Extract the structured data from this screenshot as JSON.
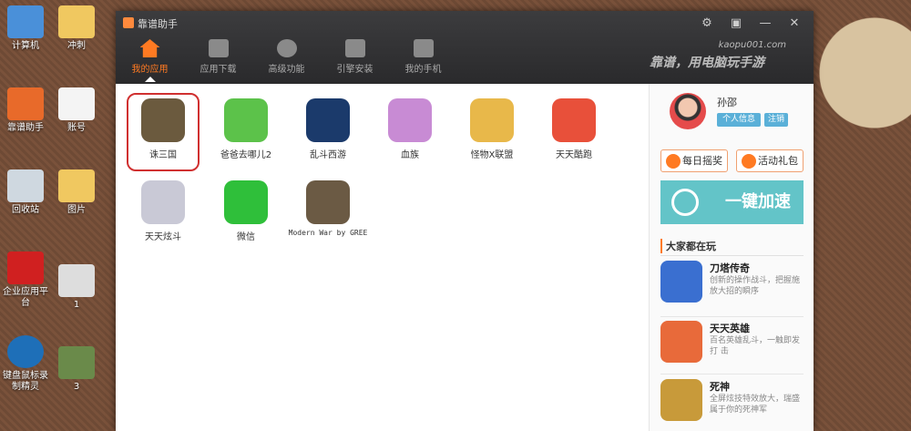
{
  "window": {
    "title": "靠谱助手",
    "site": "kaopu001.com",
    "slogan": "靠谱，用电脑玩手游",
    "controls": {
      "settings": "⚙",
      "minimize_to": "▣",
      "minimize": "—",
      "close": "✕"
    }
  },
  "nav": [
    {
      "label": "我的应用",
      "icon": "home-icon"
    },
    {
      "label": "应用下载",
      "icon": "download-icon"
    },
    {
      "label": "高级功能",
      "icon": "gears-icon"
    },
    {
      "label": "引擎安装",
      "icon": "drive-icon"
    },
    {
      "label": "我的手机",
      "icon": "phone-exit-icon"
    }
  ],
  "apps": [
    {
      "label": "诛三国",
      "color": "#6b5a3e"
    },
    {
      "label": "爸爸去哪儿2",
      "color": "#5cc24a"
    },
    {
      "label": "乱斗西游",
      "color": "#1b3a6b"
    },
    {
      "label": "血族",
      "color": "#c88bd4"
    },
    {
      "label": "怪物X联盟",
      "color": "#e8b84a"
    },
    {
      "label": "天天酷跑",
      "color": "#e8503a"
    },
    {
      "label": "天天炫斗",
      "color": "#c9c9d6"
    },
    {
      "label": "微信",
      "color": "#2fbf3a"
    },
    {
      "label": "Modern War by GREE",
      "color": "#6b5a44"
    }
  ],
  "user": {
    "name": "孙邵",
    "info_btn": "个人信息",
    "logout_btn": "注销"
  },
  "sidebar": {
    "daily": "每日摇奖",
    "gift": "活动礼包",
    "boost": "一键加速",
    "hot_title": "大家都在玩",
    "hot": [
      {
        "name": "刀塔传奇",
        "desc": "创新的操作战斗，把握施放大招的瞬序",
        "color": "#3a6fd0"
      },
      {
        "name": "天天英雄",
        "desc": "百名英雄乱斗，一触即发 打 击",
        "color": "#e86a3a"
      },
      {
        "name": "死神",
        "desc": "全屏炫技特效放大，瑞盛属于你的死神军",
        "color": "#c89a3a"
      }
    ]
  },
  "desktop": [
    {
      "label": "计算机"
    },
    {
      "label": "冲刺"
    },
    {
      "label": "靠谱助手"
    },
    {
      "label": "账号"
    },
    {
      "label": "回收站"
    },
    {
      "label": "图片"
    },
    {
      "label": "企业应用平台"
    },
    {
      "label": "1"
    },
    {
      "label": "键盘鼠标录制精灵"
    },
    {
      "label": "3"
    }
  ]
}
